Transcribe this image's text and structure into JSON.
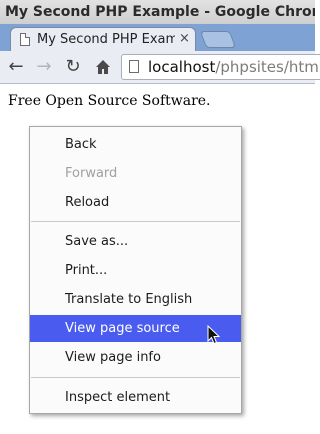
{
  "window": {
    "title": "My Second PHP Example - Google Chrome"
  },
  "tab": {
    "title": "My Second PHP Exam",
    "close_glyph": "×"
  },
  "toolbar": {
    "back_glyph": "←",
    "forward_glyph": "→",
    "reload_glyph": "↻",
    "url_host": "localhost",
    "url_path": "/phpsites/html"
  },
  "page": {
    "text": "Free Open Source Software."
  },
  "context_menu": {
    "highlight_color": "#4a5cf0",
    "items": [
      {
        "label": "Back",
        "enabled": true
      },
      {
        "label": "Forward",
        "enabled": false
      },
      {
        "label": "Reload",
        "enabled": true
      },
      {
        "label": "Save as...",
        "enabled": true
      },
      {
        "label": "Print...",
        "enabled": true
      },
      {
        "label": "Translate to English",
        "enabled": true
      },
      {
        "label": "View page source",
        "enabled": true,
        "highlighted": true
      },
      {
        "label": "View page info",
        "enabled": true
      },
      {
        "label": "Inspect element",
        "enabled": true
      }
    ]
  }
}
